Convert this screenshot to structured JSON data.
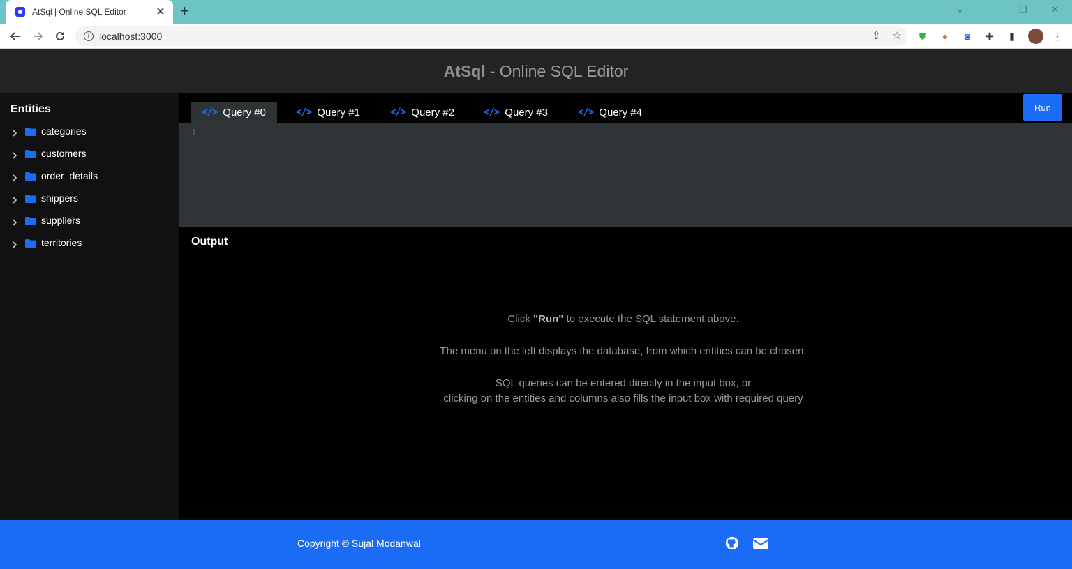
{
  "browser": {
    "tab_title": "AtSql | Online SQL Editor",
    "tab_close": "✕",
    "new_tab": "+",
    "url": "localhost:3000",
    "win_min": "—",
    "win_max": "❐",
    "win_close": "✕"
  },
  "header": {
    "brand": "AtSql",
    "subtitle": "- Online SQL Editor"
  },
  "sidebar": {
    "title": "Entities",
    "entities": [
      "categories",
      "customers",
      "order_details",
      "shippers",
      "suppliers",
      "territories"
    ]
  },
  "query_tabs": [
    "Query #0",
    "Query #1",
    "Query #2",
    "Query #3",
    "Query #4"
  ],
  "active_tab": 0,
  "run_label": "Run",
  "editor": {
    "line_number": "1"
  },
  "output": {
    "title": "Output",
    "hint_prefix": "Click ",
    "hint_bold": "\"Run\"",
    "hint_suffix": " to execute the SQL statement above.",
    "hint_2": "The menu on the left displays the database, from which entities can be chosen.",
    "hint_3a": "SQL queries can be entered directly in the input box, or",
    "hint_3b": "clicking on the entities and columns also fills the input box with required query"
  },
  "footer": {
    "copyright": "Copyright © Sujal Modanwal"
  },
  "icons": {
    "back": "back-arrow-icon",
    "forward": "forward-arrow-icon",
    "reload": "reload-icon",
    "folder": "folder-icon",
    "chevron": "chevron-right-icon",
    "github": "github-icon",
    "mail": "mail-icon"
  },
  "colors": {
    "accent": "#1a6cf5",
    "tabstrip": "#6cc4c4",
    "header_bg": "#232323",
    "editor_bg": "#2f3536"
  }
}
